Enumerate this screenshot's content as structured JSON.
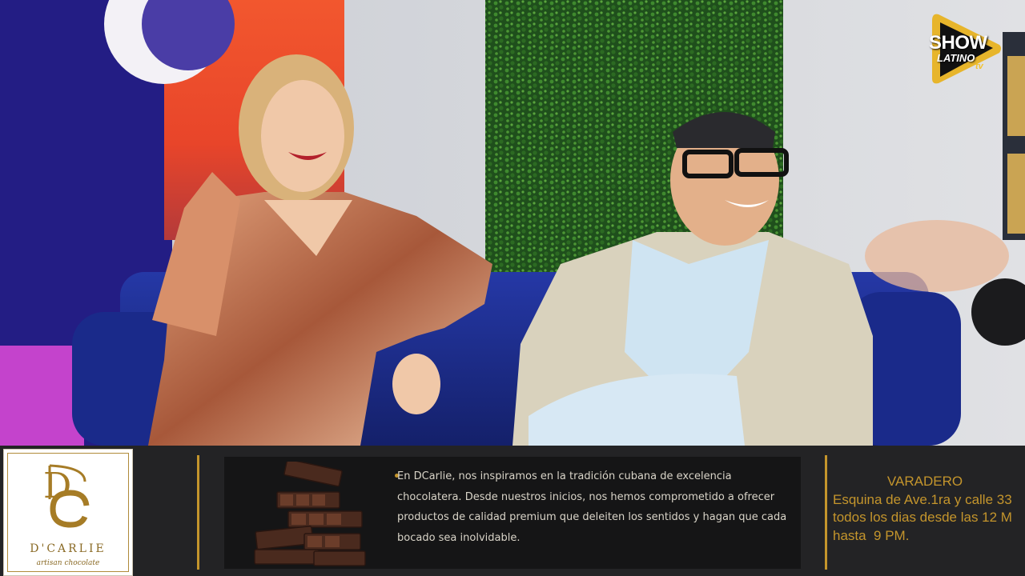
{
  "watermark": {
    "show": "SHOW",
    "latino": "LATINO",
    "tv": "tv"
  },
  "brand": {
    "monogram": "DC",
    "name": "D'CARLIE",
    "tagline": "artisan chocolate"
  },
  "promo": {
    "image": "chocolate-bars-stack",
    "text": "En DCarlie, nos inspiramos en la tradición cubana de excelencia chocolatera. Desde nuestros inicios, nos hemos comprometido a ofrecer productos de calidad premium que deleiten los sentidos y hagan que cada bocado sea inolvidable."
  },
  "address": {
    "city": "VARADERO",
    "line1": "Esquina de Ave.1ra y calle 33",
    "line2": "todos los dias desde las 12 M",
    "line3": "hasta  9 PM."
  },
  "colors": {
    "gold": "#c4952c",
    "panel": "#232325",
    "sofa": "#1d2e8a"
  }
}
